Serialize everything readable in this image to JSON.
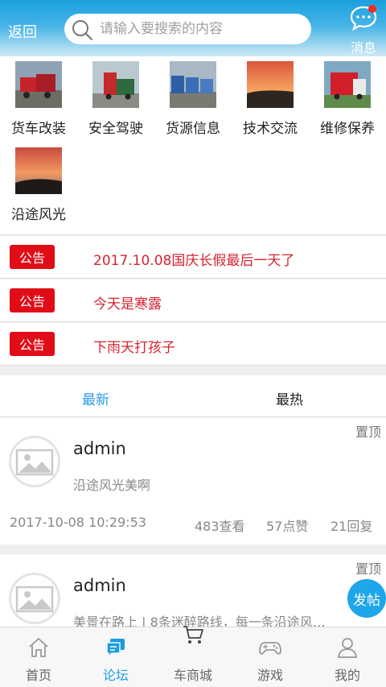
{
  "header": {
    "back_label": "返回",
    "search_placeholder": "请输入要搜索的内容",
    "message_label": "消息",
    "search_icon": "search-icon",
    "message_icon": "chat-bubble-icon"
  },
  "categories": [
    {
      "label": "货车改装"
    },
    {
      "label": "安全驾驶"
    },
    {
      "label": "货源信息"
    },
    {
      "label": "技术交流"
    },
    {
      "label": "维修保养"
    },
    {
      "label": "沿途风光"
    }
  ],
  "announcements": {
    "tag": "公告",
    "items": [
      "2017.10.08国庆长假最后一天了",
      "今天是寒露",
      "下雨天打孩子"
    ]
  },
  "tabs": {
    "latest": "最新",
    "hot": "最热"
  },
  "posts": [
    {
      "pin": "置顶",
      "author": "admin",
      "body": "沿途风光美啊",
      "time": "2017-10-08 10:29:53",
      "views": "483查看",
      "likes": "57点赞",
      "replies": "21回复"
    },
    {
      "pin": "置顶",
      "author": "admin",
      "body": "美景在路上 | 8条迷醉路线，每一条沿途风…"
    }
  ],
  "fab_label": "发帖",
  "nav": [
    {
      "label": "首页",
      "icon": "home-icon"
    },
    {
      "label": "论坛",
      "icon": "forum-icon"
    },
    {
      "label": "车商城",
      "icon": "cart-icon"
    },
    {
      "label": "游戏",
      "icon": "gamepad-icon"
    },
    {
      "label": "我的",
      "icon": "user-icon"
    }
  ],
  "colors": {
    "accent": "#1a9ce4",
    "notice_tag": "#e00d18",
    "notice_text": "#d6232f"
  }
}
